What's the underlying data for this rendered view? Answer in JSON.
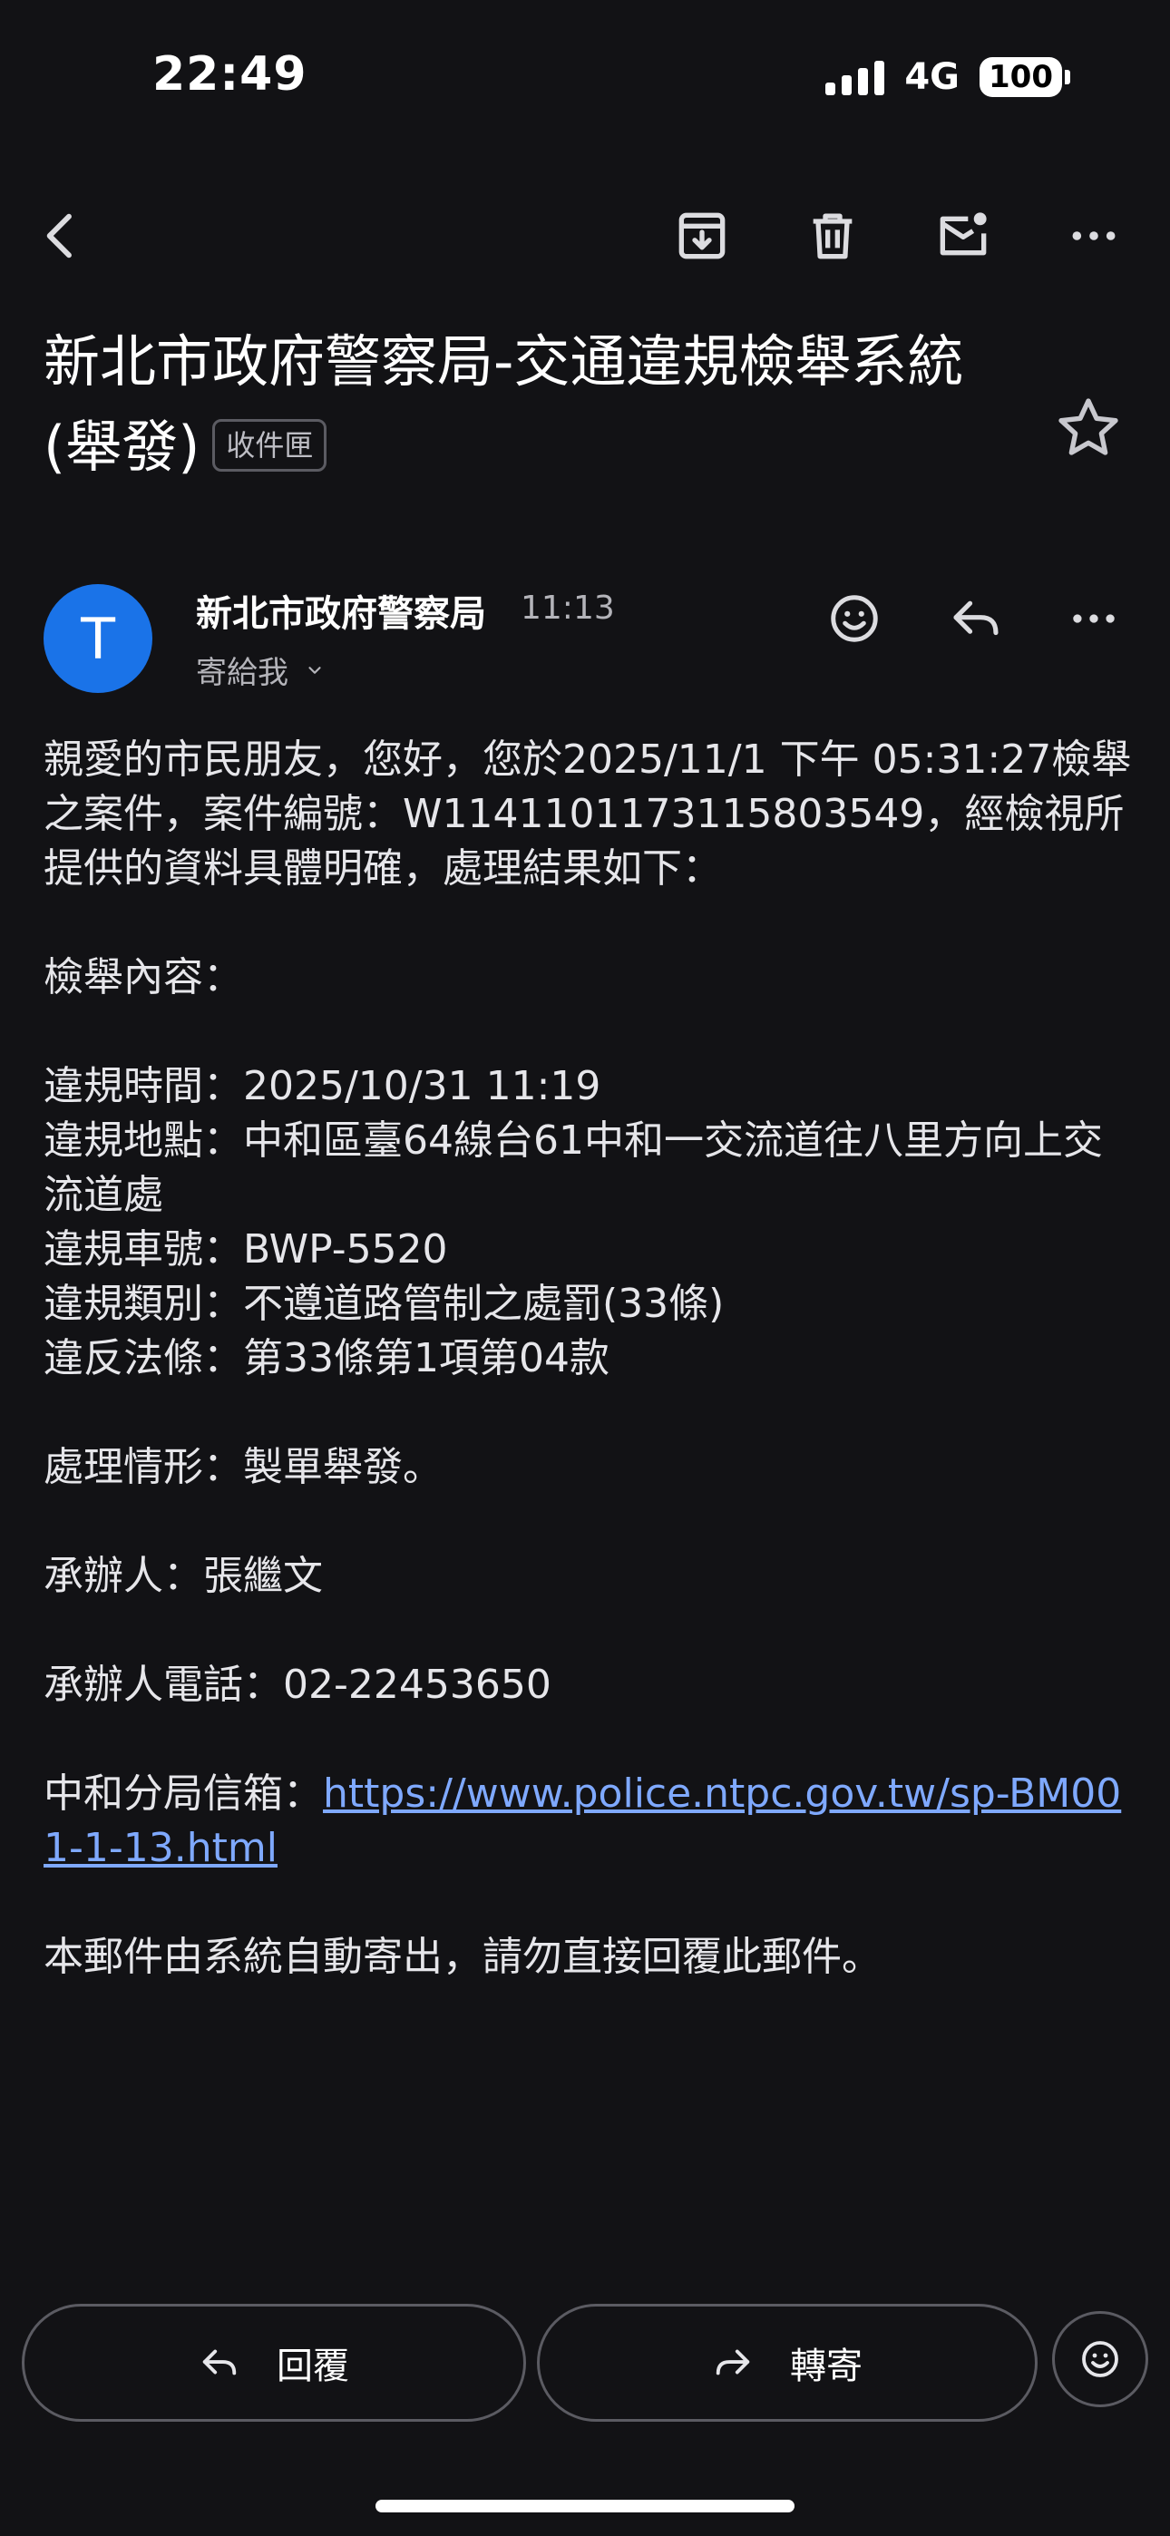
{
  "status_bar": {
    "time": "22:49",
    "network": "4G",
    "battery": "100"
  },
  "toolbar": {
    "icons": [
      "back-arrow-icon",
      "archive-icon",
      "trash-icon",
      "mark-unread-icon",
      "more-icon"
    ]
  },
  "email": {
    "subject": "新北市政府警察局-交通違規檢舉系統(舉發)",
    "label": "收件匣",
    "sender": "新北市政府警察局",
    "sender_initial": "T",
    "time": "11:13",
    "recipient": "寄給我",
    "body": [
      "親愛的市民朋友，您好，您於2025/11/1 下午 05:31:27檢舉之案件，案件編號：W1141101173115803549，經檢視所提供的資料具體明確，處理結果如下：",
      "",
      "檢舉內容：",
      "",
      "違規時間：2025/10/31 11:19",
      "違規地點：中和區臺64線台61中和一交流道往八里方向上交流道處",
      "違規車號：BWP-5520",
      "違規類別：不遵道路管制之處罰(33條)",
      "違反法條：第33條第1項第04款",
      "",
      "處理情形：製單舉發。",
      "",
      "承辦人：張繼文",
      "",
      "承辦人電話：02-22453650",
      ""
    ],
    "mailbox_label": "中和分局信箱：",
    "mailbox_link": "https://www.police.ntpc.gov.tw/sp-BM001-1-13.html",
    "footer": "本郵件由系統自動寄出，請勿直接回覆此郵件。"
  },
  "actions": {
    "reply": "回覆",
    "forward": "轉寄"
  },
  "colors": {
    "background": "#121215",
    "avatar": "#1a73e8",
    "link": "#7fa9ff"
  }
}
